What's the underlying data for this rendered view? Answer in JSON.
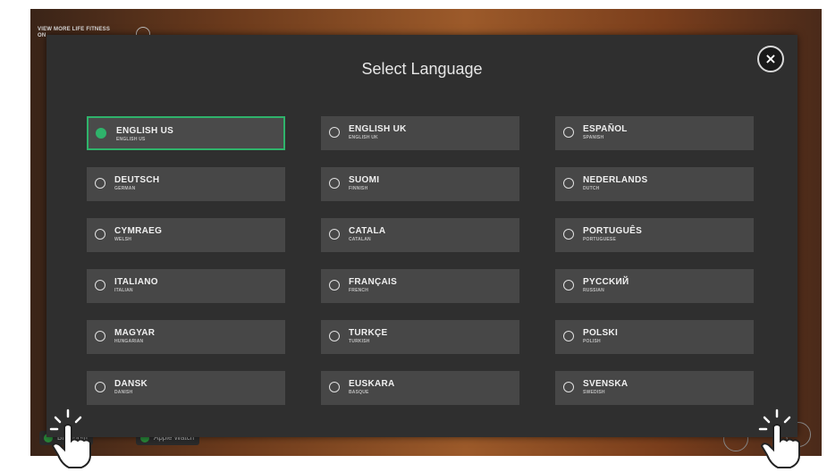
{
  "background": {
    "top_text": "VIEW MORE LIFE FITNESS\nON",
    "bottom_left_pill": "Bluetooth",
    "bottom_mid_pill": "Apple Watch"
  },
  "modal": {
    "title": "Select Language",
    "close_label": "×",
    "selected": "ENGLISH US",
    "languages": [
      {
        "name": "ENGLISH US",
        "sub": "ENGLISH US"
      },
      {
        "name": "ENGLISH UK",
        "sub": "ENGLISH UK"
      },
      {
        "name": "ESPAÑOL",
        "sub": "SPANISH"
      },
      {
        "name": "DEUTSCH",
        "sub": "GERMAN"
      },
      {
        "name": "SUOMI",
        "sub": "FINNISH"
      },
      {
        "name": "NEDERLANDS",
        "sub": "DUTCH"
      },
      {
        "name": "CYMRAEG",
        "sub": "WELSH"
      },
      {
        "name": "CATALA",
        "sub": "CATALAN"
      },
      {
        "name": "PORTUGUÊS",
        "sub": "PORTUGUESE"
      },
      {
        "name": "ITALIANO",
        "sub": "ITALIAN"
      },
      {
        "name": "FRANÇAIS",
        "sub": "FRENCH"
      },
      {
        "name": "PYCCKИЙ",
        "sub": "RUSSIAN"
      },
      {
        "name": "MAGYAR",
        "sub": "HUNGARIAN"
      },
      {
        "name": "TURKÇE",
        "sub": "TURKISH"
      },
      {
        "name": "POLSKI",
        "sub": "POLISH"
      },
      {
        "name": "DANSK",
        "sub": "DANISH"
      },
      {
        "name": "EUSKARA",
        "sub": "BASQUE"
      },
      {
        "name": "SVENSKA",
        "sub": "SWEDISH"
      }
    ]
  },
  "colors": {
    "accent": "#2fb36b",
    "modal_bg": "#2f2f2f",
    "option_bg": "#474747"
  },
  "icons": [
    "close-icon",
    "radio-icon",
    "tap-hand-icon"
  ]
}
